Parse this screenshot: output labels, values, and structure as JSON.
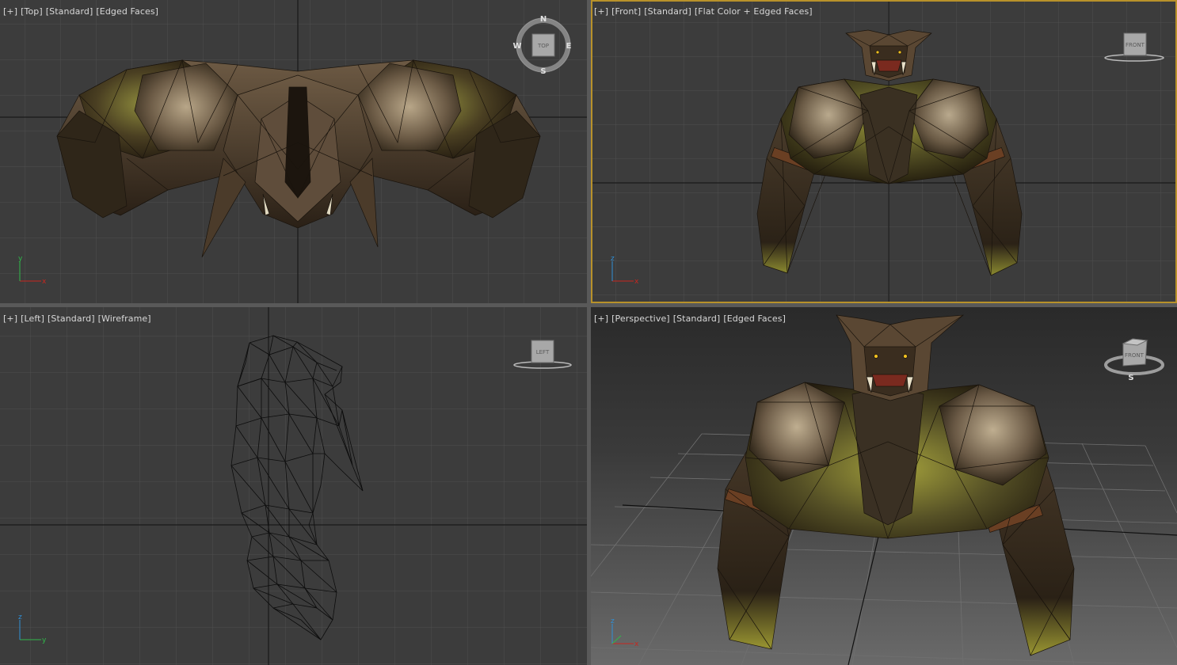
{
  "viewports": {
    "top": {
      "labels": [
        "[+]",
        "[Top]",
        "[Standard]",
        "[Edged Faces]"
      ],
      "axes": [
        "x",
        "y"
      ],
      "active": false
    },
    "front": {
      "labels": [
        "[+]",
        "[Front]",
        "[Standard]",
        "[Flat Color + Edged Faces]"
      ],
      "axes": [
        "x",
        "z"
      ],
      "active": true
    },
    "left": {
      "labels": [
        "[+]",
        "[Left]",
        "[Standard]",
        "[Wireframe]"
      ],
      "axes": [
        "y",
        "z"
      ],
      "active": false
    },
    "perspective": {
      "labels": [
        "[+]",
        "[Perspective]",
        "[Standard]",
        "[Edged Faces]"
      ],
      "axes": [
        "x",
        "z"
      ],
      "active": false
    }
  },
  "viewcube": {
    "top": {
      "face": "TOP",
      "compass": {
        "n": "N",
        "e": "E",
        "s": "S",
        "w": "W"
      }
    },
    "front": {
      "face": "FRONT"
    },
    "left": {
      "face": "LEFT"
    },
    "perspective": {
      "face": "FRONT",
      "compass_s": "S"
    }
  },
  "colors": {
    "viewport_bg": "#3c3c3c",
    "grid": "#4e4e4e",
    "axis": "#101010",
    "active_border": "#b8912a",
    "divider": "#595959"
  }
}
